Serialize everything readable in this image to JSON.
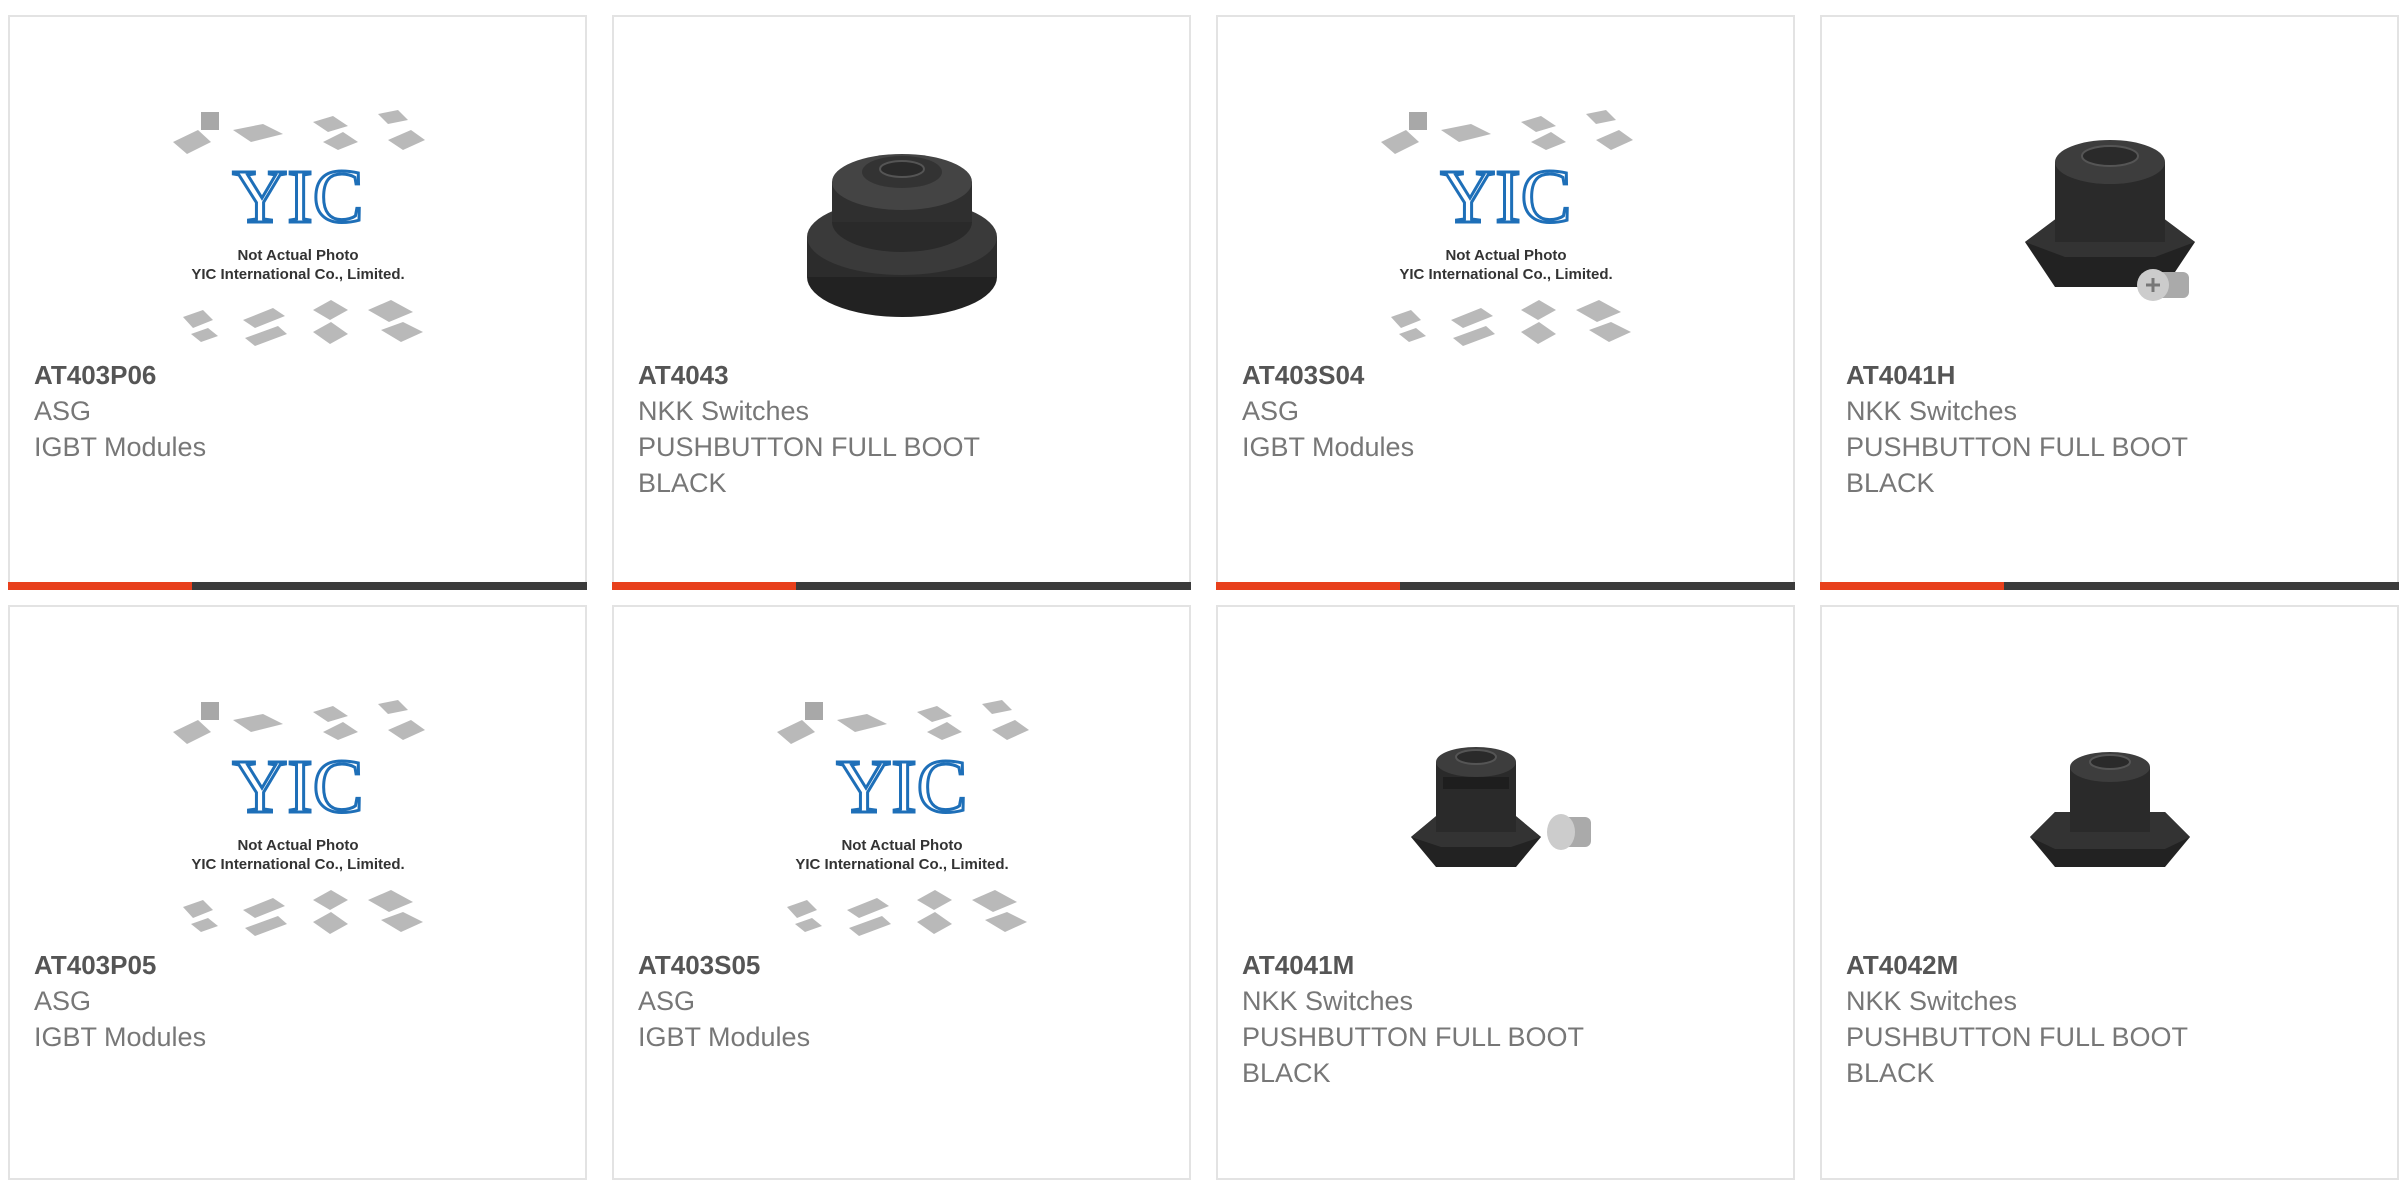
{
  "products": [
    {
      "part_number": "AT403P06",
      "manufacturer": "ASG",
      "description": "IGBT Modules",
      "image": "placeholder"
    },
    {
      "part_number": "AT4043",
      "manufacturer": "NKK Switches",
      "description": "PUSHBUTTON FULL BOOT BLACK",
      "image": "boot-round"
    },
    {
      "part_number": "AT403S04",
      "manufacturer": "ASG",
      "description": "IGBT Modules",
      "image": "placeholder"
    },
    {
      "part_number": "AT4041H",
      "manufacturer": "NKK Switches",
      "description": "PUSHBUTTON FULL BOOT BLACK",
      "image": "boot-hex-screw"
    },
    {
      "part_number": "AT403P05",
      "manufacturer": "ASG",
      "description": "IGBT Modules",
      "image": "placeholder"
    },
    {
      "part_number": "AT403S05",
      "manufacturer": "ASG",
      "description": "IGBT Modules",
      "image": "placeholder"
    },
    {
      "part_number": "AT4041M",
      "manufacturer": "NKK Switches",
      "description": "PUSHBUTTON FULL BOOT BLACK",
      "image": "boot-small-screw"
    },
    {
      "part_number": "AT4042M",
      "manufacturer": "NKK Switches",
      "description": "PUSHBUTTON FULL BOOT BLACK",
      "image": "boot-hex"
    }
  ],
  "placeholder": {
    "logo_text": "YIC",
    "line1": "Not Actual Photo",
    "line2": "YIC International Co., Limited."
  },
  "colors": {
    "accent": "#e8401c",
    "bar": "#3b3b3b",
    "border": "#e3e3e3",
    "logo": "#1e6fb8"
  }
}
